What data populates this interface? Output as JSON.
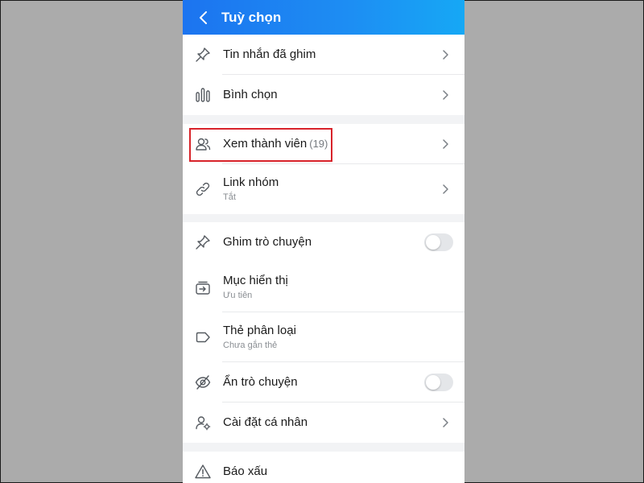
{
  "header": {
    "title": "Tuỳ chọn"
  },
  "section1": {
    "items": [
      {
        "label": "Tin nhắn đã ghim"
      },
      {
        "label": "Bình chọn"
      }
    ]
  },
  "section2": {
    "items": [
      {
        "label": "Xem thành viên",
        "count": "(19)"
      },
      {
        "label": "Link nhóm",
        "sub": "Tắt"
      }
    ]
  },
  "section3": {
    "items": [
      {
        "label": "Ghim trò chuyện",
        "toggle_on": false
      },
      {
        "label": "Mục hiển thị",
        "sub": "Ưu tiên"
      },
      {
        "label": "Thẻ phân loại",
        "sub": "Chưa gắn thẻ"
      },
      {
        "label": "Ẩn trò chuyện",
        "toggle_on": false
      },
      {
        "label": "Cài đặt cá nhân"
      }
    ]
  },
  "section4": {
    "items": [
      {
        "label": "Báo xấu"
      }
    ]
  },
  "colors": {
    "header_start": "#1c74f0",
    "header_end": "#16a8f5",
    "highlight": "#d8232a",
    "background": "#ababab"
  }
}
